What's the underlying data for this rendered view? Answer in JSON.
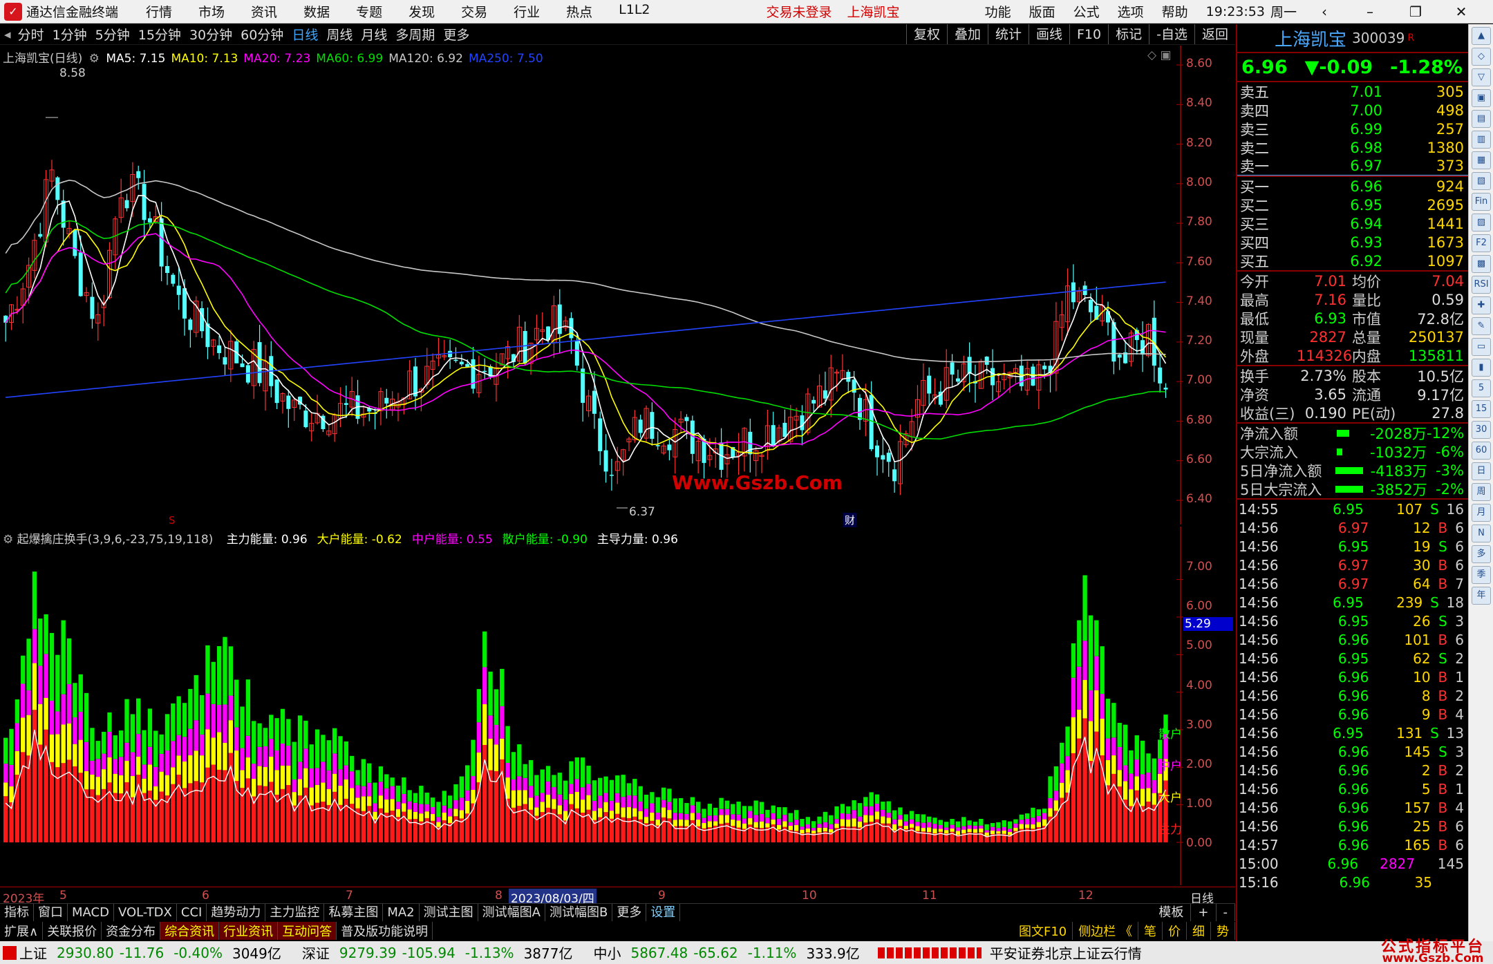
{
  "titlebar": {
    "app_title": "通达信金融终端",
    "menus": [
      "行情",
      "市场",
      "资讯",
      "数据",
      "专题",
      "发现",
      "交易",
      "行业",
      "热点",
      "L1L2"
    ],
    "center": [
      "交易未登录",
      "上海凯宝"
    ],
    "right": [
      "功能",
      "版面",
      "公式",
      "选项",
      "帮助"
    ],
    "time": "19:23:53",
    "weekday": "周一"
  },
  "periods": [
    "分时",
    "1分钟",
    "5分钟",
    "15分钟",
    "30分钟",
    "60分钟",
    "日线",
    "周线",
    "月线",
    "多周期",
    "更多"
  ],
  "active_period": "日线",
  "toolbar_right": [
    "复权",
    "叠加",
    "统计",
    "画线",
    "F10",
    "标记",
    "-自选",
    "返回"
  ],
  "main": {
    "stock_label": "上海凯宝(日线)",
    "ma": [
      {
        "t": "MA5: 7.15",
        "c": "#ffffff"
      },
      {
        "t": "MA10: 7.13",
        "c": "#ffff00"
      },
      {
        "t": "MA20: 7.23",
        "c": "#ff00ff"
      },
      {
        "t": "MA60: 6.99",
        "c": "#00dd00"
      },
      {
        "t": "MA120: 6.92",
        "c": "#c8c8c8"
      },
      {
        "t": "MA250: 7.50",
        "c": "#2244ff"
      }
    ],
    "high_label": "8.58",
    "low_label": "6.37",
    "watermark": "Www.Gszb.Com",
    "marker_s": "S",
    "marker_cai": "财"
  },
  "sub": {
    "title": "起爆擒庄换手(3,9,6,-23,75,19,118)",
    "vals": [
      {
        "t": "主力能量: 0.96",
        "c": "#ffffff"
      },
      {
        "t": "大户能量: -0.62",
        "c": "#ffff00"
      },
      {
        "t": "中户能量: 0.55",
        "c": "#ff00ff"
      },
      {
        "t": "散户能量: -0.90",
        "c": "#00ff00"
      },
      {
        "t": "主导力量: 0.96",
        "c": "#ffffff"
      }
    ],
    "current_value": "5.29",
    "side_labels": [
      "散户",
      "中户",
      "大户",
      "主力"
    ]
  },
  "xaxis": {
    "labels": [
      "2023年",
      "5",
      "6",
      "7",
      "8",
      "2023/08/03/四",
      "9",
      "10",
      "11",
      "12"
    ],
    "right": "日线"
  },
  "ind_tabs": [
    "指标",
    "窗口",
    "MACD",
    "VOL-TDX",
    "CCI",
    "趋势动力",
    "主力监控",
    "私募主图",
    "MA2",
    "测试主图",
    "测试幅图A",
    "测试幅图B",
    "更多",
    "设置"
  ],
  "ind_right": [
    "模板",
    "+",
    "-"
  ],
  "bottom_tabs": [
    "扩展∧",
    "关联报价",
    "资金分布",
    "综合资讯",
    "行业资讯",
    "互动问答",
    "普及版功能说明"
  ],
  "bottom_right": [
    "图文F10",
    "侧边栏 《",
    "笔",
    "价",
    "细",
    "势"
  ],
  "status": {
    "sh_name": "上证",
    "sh": "2930.80",
    "sh_chg": "-11.76",
    "sh_pct": "-0.40%",
    "sh_amt": "3049亿",
    "sz_name": "深证",
    "sz": "9279.39",
    "sz_chg": "-105.94",
    "sz_pct": "-1.13%",
    "sz_amt": "3877亿",
    "zx_name": "中小",
    "zx": "5867.48",
    "zx_chg": "-65.62",
    "zx_pct": "-1.11%",
    "zx_amt": "333.9亿",
    "broker": "平安证券北京上证云行情",
    "brand": "公式指标平台",
    "brand_url": "www.Gszb.Com"
  },
  "quote": {
    "name": "上海凯宝",
    "code": "300039",
    "flag": "R",
    "price": "6.96",
    "chg": "▼-0.09",
    "pct": "-1.28%",
    "asks": [
      [
        "卖五",
        "7.01",
        "305"
      ],
      [
        "卖四",
        "7.00",
        "498"
      ],
      [
        "卖三",
        "6.99",
        "257"
      ],
      [
        "卖二",
        "6.98",
        "1380"
      ],
      [
        "卖一",
        "6.97",
        "373"
      ]
    ],
    "bids": [
      [
        "买一",
        "6.96",
        "924"
      ],
      [
        "买二",
        "6.95",
        "2695"
      ],
      [
        "买三",
        "6.94",
        "1441"
      ],
      [
        "买四",
        "6.93",
        "1673"
      ],
      [
        "买五",
        "6.92",
        "1097"
      ]
    ],
    "stats": [
      [
        "今开",
        "7.01",
        "均价",
        "7.04"
      ],
      [
        "最高",
        "7.16",
        "量比",
        "0.59"
      ],
      [
        "最低",
        "6.93",
        "市值",
        "72.8亿"
      ],
      [
        "现量",
        "2827",
        "总量",
        "250137"
      ],
      [
        "外盘",
        "114326",
        "内盘",
        "135811"
      ]
    ],
    "fund": [
      [
        "换手",
        "2.73%",
        "股本",
        "10.5亿"
      ],
      [
        "净资",
        "3.65",
        "流通",
        "9.17亿"
      ],
      [
        "收益(三)",
        "0.190",
        "PE(动)",
        "27.8"
      ]
    ],
    "flows": [
      [
        "净流入额",
        "-2028万",
        "-12%"
      ],
      [
        "大宗流入",
        "-1032万",
        "-6%"
      ],
      [
        "5日净流入额",
        "-4183万",
        "-3%"
      ],
      [
        "5日大宗流入",
        "-3852万",
        "-2%"
      ]
    ],
    "ticks": [
      [
        "14:55",
        "6.95",
        "107",
        "S",
        "16"
      ],
      [
        "14:56",
        "6.97",
        "12",
        "B",
        "6"
      ],
      [
        "14:56",
        "6.95",
        "19",
        "S",
        "6"
      ],
      [
        "14:56",
        "6.97",
        "30",
        "B",
        "6"
      ],
      [
        "14:56",
        "6.97",
        "64",
        "B",
        "7"
      ],
      [
        "14:56",
        "6.95",
        "239",
        "S",
        "18"
      ],
      [
        "14:56",
        "6.95",
        "26",
        "S",
        "3"
      ],
      [
        "14:56",
        "6.96",
        "101",
        "B",
        "6"
      ],
      [
        "14:56",
        "6.95",
        "62",
        "S",
        "2"
      ],
      [
        "14:56",
        "6.96",
        "10",
        "B",
        "1"
      ],
      [
        "14:56",
        "6.96",
        "8",
        "B",
        "2"
      ],
      [
        "14:56",
        "6.96",
        "9",
        "B",
        "4"
      ],
      [
        "14:56",
        "6.95",
        "131",
        "S",
        "13"
      ],
      [
        "14:56",
        "6.96",
        "145",
        "S",
        "3"
      ],
      [
        "14:56",
        "6.96",
        "2",
        "B",
        "2"
      ],
      [
        "14:56",
        "6.96",
        "5",
        "B",
        "1"
      ],
      [
        "14:56",
        "6.96",
        "157",
        "B",
        "4"
      ],
      [
        "14:56",
        "6.96",
        "25",
        "B",
        "6"
      ],
      [
        "14:57",
        "6.96",
        "165",
        "B",
        "6"
      ],
      [
        "15:00",
        "6.96",
        "2827",
        "",
        "145"
      ],
      [
        "15:16",
        "6.96",
        "35",
        "",
        ""
      ]
    ]
  },
  "side_tools": [
    "▲",
    "◇",
    "▽",
    "▣",
    "▤",
    "▥",
    "▦",
    "▧",
    "Fin",
    "▨",
    "F2",
    "▩",
    "RSI",
    "✚",
    "✎",
    "▭",
    "▮",
    "5",
    "15",
    "30",
    "60",
    "日",
    "周",
    "月",
    "N",
    "多",
    "季",
    "年"
  ],
  "chart_data": {
    "type": "candlestick",
    "yaxis_main": [
      "8.60",
      "8.40",
      "8.20",
      "8.00",
      "7.80",
      "7.60",
      "7.40",
      "7.20",
      "7.00",
      "6.80",
      "6.60",
      "6.40"
    ],
    "yaxis_sub": [
      "7.00",
      "6.00",
      "5.00",
      "4.00",
      "3.00",
      "2.00",
      "1.00",
      "0.00"
    ]
  }
}
